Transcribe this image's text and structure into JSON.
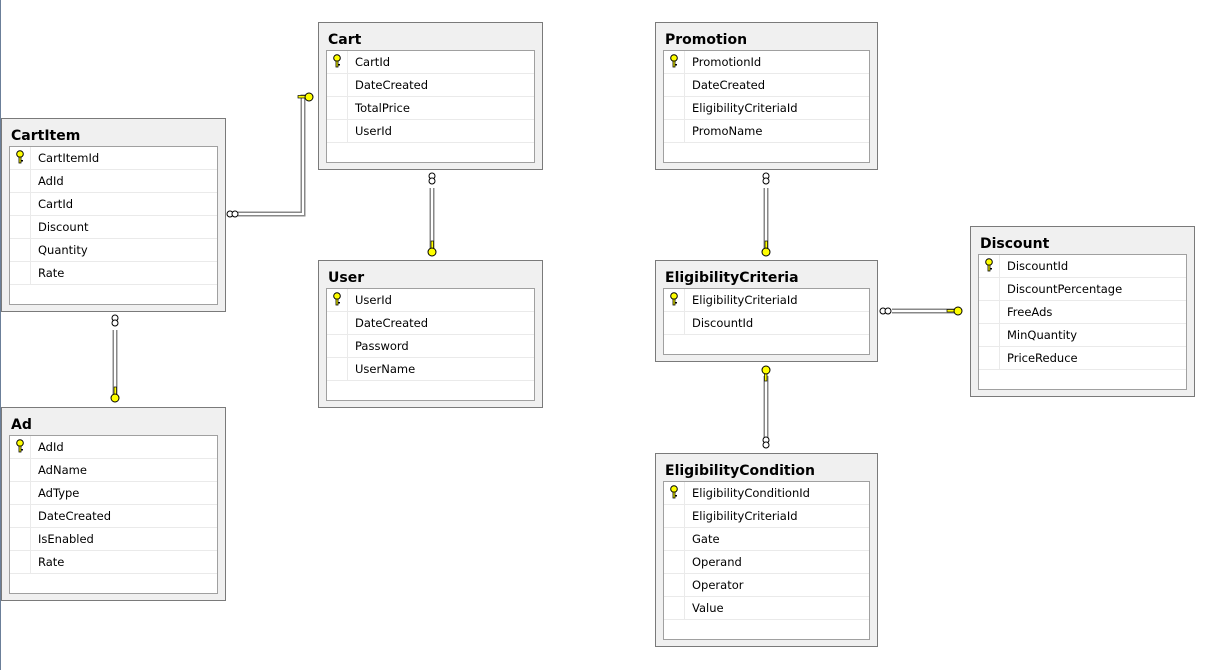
{
  "tables": [
    {
      "name": "Cart",
      "columns": [
        {
          "name": "CartId",
          "pk": true
        },
        {
          "name": "DateCreated"
        },
        {
          "name": "TotalPrice"
        },
        {
          "name": "UserId"
        }
      ]
    },
    {
      "name": "CartItem",
      "columns": [
        {
          "name": "CartItemId",
          "pk": true
        },
        {
          "name": "AdId"
        },
        {
          "name": "CartId"
        },
        {
          "name": "Discount"
        },
        {
          "name": "Quantity"
        },
        {
          "name": "Rate"
        }
      ]
    },
    {
      "name": "User",
      "columns": [
        {
          "name": "UserId",
          "pk": true
        },
        {
          "name": "DateCreated"
        },
        {
          "name": "Password"
        },
        {
          "name": "UserName"
        }
      ]
    },
    {
      "name": "Ad",
      "columns": [
        {
          "name": "AdId",
          "pk": true
        },
        {
          "name": "AdName"
        },
        {
          "name": "AdType"
        },
        {
          "name": "DateCreated"
        },
        {
          "name": "IsEnabled"
        },
        {
          "name": "Rate"
        }
      ]
    },
    {
      "name": "Promotion",
      "columns": [
        {
          "name": "PromotionId",
          "pk": true
        },
        {
          "name": "DateCreated"
        },
        {
          "name": "EligibilityCriteriaId"
        },
        {
          "name": "PromoName"
        }
      ]
    },
    {
      "name": "EligibilityCriteria",
      "columns": [
        {
          "name": "EligibilityCriteriaId",
          "pk": true
        },
        {
          "name": "DiscountId"
        }
      ]
    },
    {
      "name": "Discount",
      "columns": [
        {
          "name": "DiscountId",
          "pk": true
        },
        {
          "name": "DiscountPercentage"
        },
        {
          "name": "FreeAds"
        },
        {
          "name": "MinQuantity"
        },
        {
          "name": "PriceReduce"
        }
      ]
    },
    {
      "name": "EligibilityCondition",
      "columns": [
        {
          "name": "EligibilityConditionId",
          "pk": true
        },
        {
          "name": "EligibilityCriteriaId"
        },
        {
          "name": "Gate"
        },
        {
          "name": "Operand"
        },
        {
          "name": "Operator"
        },
        {
          "name": "Value"
        }
      ]
    }
  ],
  "relationships": [
    {
      "many": "CartItem",
      "one": "Cart"
    },
    {
      "many": "Cart",
      "one": "User"
    },
    {
      "many": "CartItem",
      "one": "Ad"
    },
    {
      "many": "Promotion",
      "one": "EligibilityCriteria"
    },
    {
      "many": "EligibilityCriteria",
      "one": "Discount"
    },
    {
      "many": "EligibilityCondition",
      "one": "EligibilityCriteria"
    }
  ],
  "colors": {
    "key": "#ffff00",
    "table_bg": "#f0f0f0",
    "border": "#7a7a7a"
  }
}
